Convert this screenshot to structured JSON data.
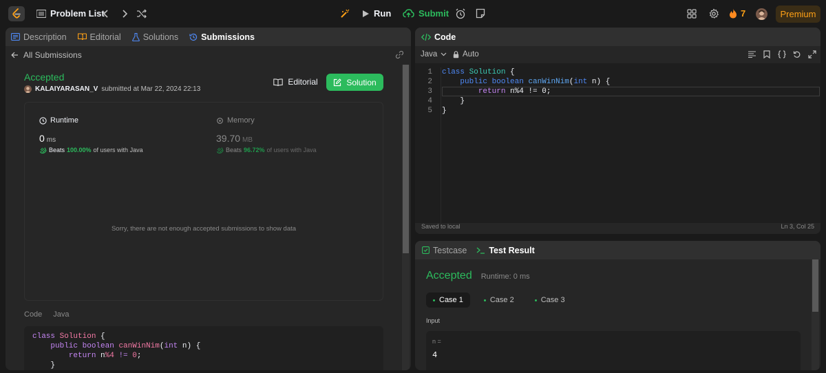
{
  "topbar": {
    "problem_list": "Problem List",
    "run": "Run",
    "submit": "Submit",
    "streak": "7",
    "premium": "Premium"
  },
  "left": {
    "tabs": [
      {
        "label": "Description"
      },
      {
        "label": "Editorial"
      },
      {
        "label": "Solutions"
      },
      {
        "label": "Submissions"
      }
    ],
    "back_label": "All Submissions",
    "status": "Accepted",
    "username": "KALAIYARASAN_V",
    "submitted_text": "submitted at Mar 22, 2024 22:13",
    "editorial_btn": "Editorial",
    "solution_btn": "Solution",
    "runtime": {
      "title": "Runtime",
      "value": "0",
      "unit": "ms",
      "beats_prefix": "Beats",
      "beats_pct": "100.00%",
      "beats_suffix": "of users with Java"
    },
    "memory": {
      "title": "Memory",
      "value": "39.70",
      "unit": "MB",
      "beats_prefix": "Beats",
      "beats_pct": "96.72%",
      "beats_suffix": "of users with Java"
    },
    "empty_msg": "Sorry, there are not enough accepted submissions to show data",
    "code_label": "Code",
    "code_lang": "Java",
    "code": {
      "l1_kw": "class",
      "l1_cls": "Solution",
      "l1_rest": "{",
      "l2_kw1": "public",
      "l2_kw2": "boolean",
      "l2_fn": "canWinNim",
      "l2_open": "(",
      "l2_type": "int",
      "l2_rest": "n) {",
      "l3_kw": "return",
      "l3_a": "n",
      "l3_op": "%4",
      "l3_b": "!=",
      "l3_num": "0",
      "l3_end": ";",
      "l4": "}"
    }
  },
  "editor": {
    "title": "Code",
    "lang": "Java",
    "mode": "Auto",
    "line_numbers": [
      "1",
      "2",
      "3",
      "4",
      "5"
    ],
    "lines": {
      "l1_kw": "class",
      "l1_cls": "Solution",
      "l1_rest": "{",
      "l2_kw1": "public",
      "l2_kw2": "boolean",
      "l2_fn": "canWinNim",
      "l2_type": "int",
      "l2_rest": "n) {",
      "l3_kw": "return",
      "l3_rest": "n%4 != 0;",
      "l4": "}",
      "l5": "}"
    },
    "saved": "Saved to local",
    "cursor": "Ln 3, Col 25"
  },
  "result": {
    "tab_testcase": "Testcase",
    "tab_result": "Test Result",
    "status": "Accepted",
    "runtime": "Runtime: 0 ms",
    "cases": [
      {
        "label": "Case 1"
      },
      {
        "label": "Case 2"
      },
      {
        "label": "Case 3"
      }
    ],
    "input_label": "Input",
    "var_name": "n =",
    "var_value": "4"
  },
  "colors": {
    "accent_green": "#2cbb5d",
    "accepted_green": "#2cbb5d",
    "premium": "#ffa116",
    "bg": "#1a1a1a",
    "panel": "#262626"
  }
}
